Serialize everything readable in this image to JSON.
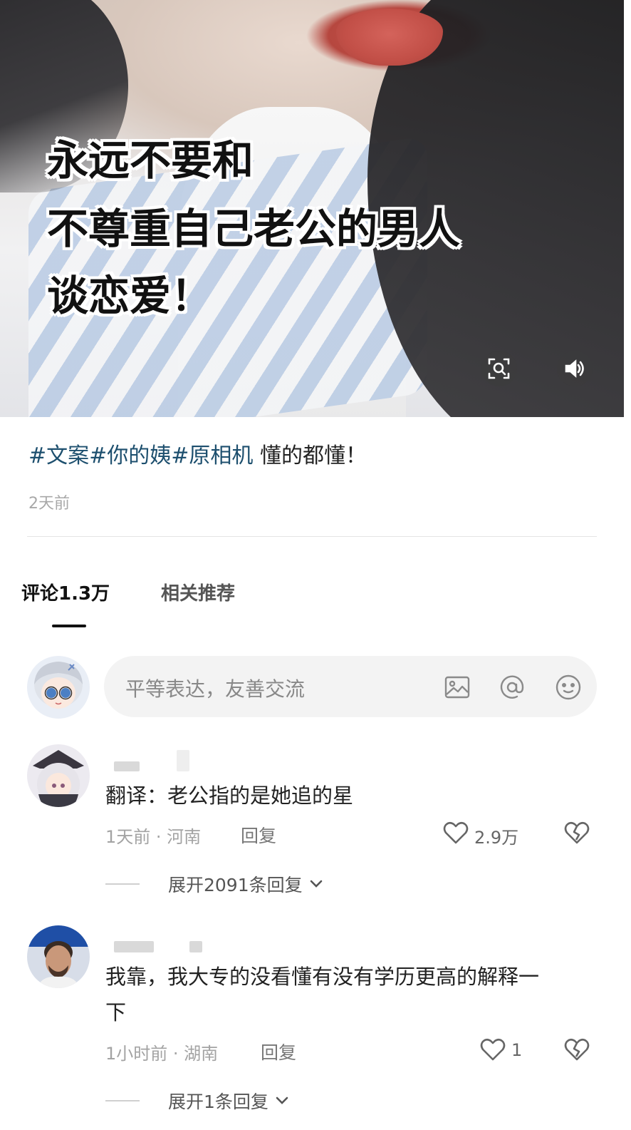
{
  "video": {
    "overlay_lines": [
      "永远不要和",
      "不尊重自己老公的男人",
      "谈恋爱！"
    ],
    "buttons": [
      "search-image-icon",
      "volume-icon"
    ]
  },
  "post": {
    "hashtags": "#文案#你的姨#原相机",
    "caption": "懂的都懂！",
    "time": "2天前"
  },
  "tabs": {
    "comments": "评论1.3万",
    "related": "相关推荐"
  },
  "comment_input": {
    "placeholder": "平等表达，友善交流",
    "icons": [
      "image-icon",
      "at-icon",
      "emoji-icon"
    ]
  },
  "comments": [
    {
      "text": "翻译：老公指的是她追的星",
      "time_location": "1天前 · 河南",
      "reply_label": "回复",
      "likes": "2.9万",
      "expand_label": "展开2091条回复"
    },
    {
      "text_line1": "我靠，我大专的没看懂有没有学历更高的解释一",
      "text_line2": "下",
      "time_location": "1小时前 · 湖南",
      "reply_label": "回复",
      "likes": "1",
      "expand_label": "展开1条回复"
    }
  ],
  "colors": {
    "hashtag": "#1d4f6e",
    "muted": "#a3a3a3",
    "input_bg": "#f3f3f3"
  }
}
